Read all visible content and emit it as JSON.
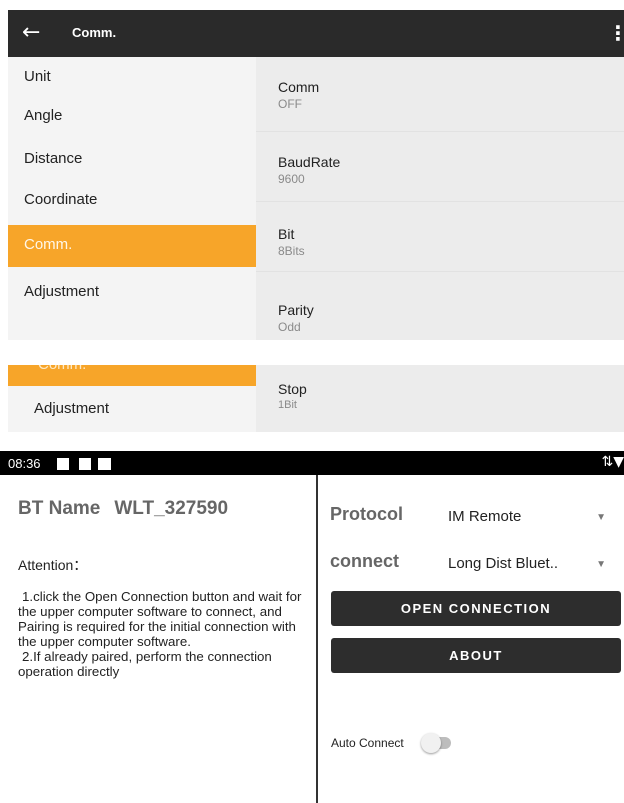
{
  "settings_screen": {
    "app_bar": {
      "title": "Comm.",
      "back_icon": "arrow-left-icon",
      "menu_icon": "more-vert-icon"
    },
    "menu": [
      {
        "label": "Unit",
        "active": false
      },
      {
        "label": "Angle",
        "active": false
      },
      {
        "label": "Distance",
        "active": false
      },
      {
        "label": "Coordinate",
        "active": false
      },
      {
        "label": "Comm.",
        "active": true
      },
      {
        "label": "Adjustment",
        "active": false
      }
    ],
    "settings": [
      {
        "name": "Comm",
        "value": "OFF"
      },
      {
        "name": "BaudRate",
        "value": "9600"
      },
      {
        "name": "Bit",
        "value": "8Bits"
      },
      {
        "name": "Parity",
        "value": "Odd"
      }
    ],
    "accent_color": "#f7a529"
  },
  "settings_crop": {
    "menu_active": "Comm.",
    "menu_next": "Adjustment",
    "setting": {
      "name": "Stop",
      "value": "1Bit"
    }
  },
  "bt_screen": {
    "status_bar": {
      "time": "08:36",
      "right_icons": "⇅▼"
    },
    "bt_name_label": "BT Name",
    "bt_name_value": "WLT_327590",
    "attention": "Attention：",
    "instructions": [
      "1.click the Open Connection button and wait for the upper computer software to connect, and Pairing is required for the initial connection with the upper computer software.",
      "2.If already paired, perform the connection operation directly"
    ],
    "protocol_label": "Protocol",
    "protocol_value": "IM Remote",
    "connect_label": "connect",
    "connect_value": "Long Dist Bluet..",
    "open_connection_label": "OPEN CONNECTION",
    "about_label": "ABOUT",
    "auto_connect_label": "Auto Connect",
    "auto_connect_on": false
  }
}
